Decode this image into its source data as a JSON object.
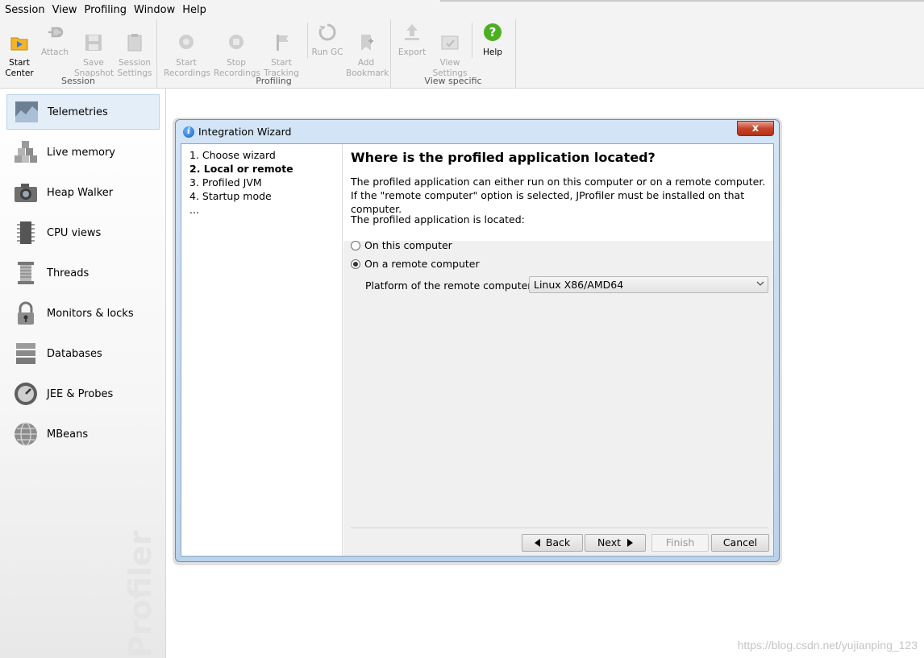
{
  "menu": {
    "items": [
      {
        "label": "Session"
      },
      {
        "label": "View"
      },
      {
        "label": "Profiling"
      },
      {
        "label": "Window"
      },
      {
        "label": "Help"
      }
    ]
  },
  "toolbar": {
    "session_group": {
      "label": "Session",
      "start_center": "Start\nCenter",
      "attach": "Attach",
      "save_snapshot": "Save\nSnapshot",
      "session_settings": "Session\nSettings"
    },
    "profiling_group": {
      "label": "Profiling",
      "start_recordings": "Start\nRecordings",
      "stop_recordings": "Stop\nRecordings",
      "start_tracking": "Start\nTracking",
      "run_gc": "Run GC",
      "add_bookmark": "Add\nBookmark"
    },
    "view_group": {
      "label": "View specific",
      "export": "Export",
      "view_settings": "View\nSettings",
      "help": "Help"
    }
  },
  "sidebar": {
    "items": [
      {
        "label": "Telemetries",
        "icon": "telemetries-icon",
        "selected": true
      },
      {
        "label": "Live memory",
        "icon": "live-memory-icon"
      },
      {
        "label": "Heap Walker",
        "icon": "camera-icon"
      },
      {
        "label": "CPU views",
        "icon": "cpu-chip-icon"
      },
      {
        "label": "Threads",
        "icon": "threads-spool-icon"
      },
      {
        "label": "Monitors & locks",
        "icon": "padlock-icon"
      },
      {
        "label": "Databases",
        "icon": "database-icon"
      },
      {
        "label": "JEE & Probes",
        "icon": "gauge-icon"
      },
      {
        "label": "MBeans",
        "icon": "globe-icon"
      }
    ],
    "watermark": "Profiler"
  },
  "dialog": {
    "title": "Integration Wizard",
    "close_label": "x",
    "steps": [
      {
        "label": "1. Choose wizard"
      },
      {
        "label": "2. Local or remote",
        "current": true
      },
      {
        "label": "3. Profiled JVM"
      },
      {
        "label": "4. Startup mode"
      },
      {
        "label": "..."
      }
    ],
    "heading": "Where is the profiled application located?",
    "description": "The profiled application can either run on this computer or on a remote computer. If the \"remote computer\" option is selected, JProfiler must be installed on that computer.",
    "located_label": "The profiled application is located:",
    "options": {
      "local": {
        "label": "On this computer",
        "checked": false
      },
      "remote": {
        "label": "On a remote computer",
        "checked": true
      }
    },
    "platform_label": "Platform of the remote computer:",
    "platform_value": "Linux X86/AMD64",
    "buttons": {
      "back": "Back",
      "next": "Next",
      "finish": "Finish",
      "cancel": "Cancel"
    }
  },
  "watermark_url": "https://blog.csdn.net/yujianping_123",
  "colors": {
    "dialog_frame": "#bad3ec",
    "close_button": "#c7442a",
    "selected_item_bg": "#e3eef8",
    "help_icon": "#4caf22"
  }
}
